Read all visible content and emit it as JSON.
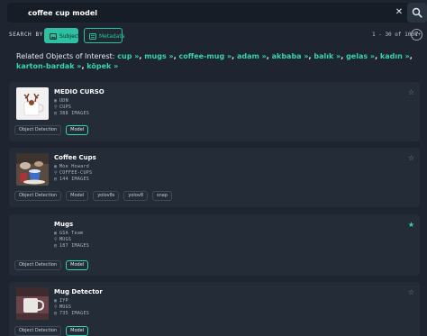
{
  "search": {
    "value": "coffee cup model",
    "clear_label": "✕"
  },
  "search_by": {
    "label": "SEARCH BY:",
    "subject_label": "Subject",
    "metadata_label": "Metadata",
    "result_count": "1 - 30 of 100k+",
    "info_label": "?"
  },
  "related": {
    "title": "Related Objects of Interest:",
    "items": [
      "cup",
      "mugs",
      "coffee-mug",
      "adam",
      "akbaba",
      "balık",
      "gelas",
      "kadın",
      "karton-bardak",
      "köpek"
    ]
  },
  "results": [
    {
      "title": "MEDIO CURSO",
      "owner": "UDN",
      "category": "CUPS",
      "images": "388 IMAGES",
      "favorite": false,
      "tags": [
        "Object Detection",
        "Model"
      ]
    },
    {
      "title": "Coffee Cups",
      "owner": "Moe Howard",
      "category": "COFFEE-CUPS",
      "images": "144 IMAGES",
      "favorite": false,
      "tags": [
        "Object Detection",
        "Model",
        "yolov8s",
        "yolov8",
        "snap"
      ]
    },
    {
      "title": "Mugs",
      "owner": "GSA Team",
      "category": "MUGS",
      "images": "187 IMAGES",
      "favorite": true,
      "tags": [
        "Object Detection",
        "Model"
      ]
    },
    {
      "title": "Mug Detector",
      "owner": "IYP",
      "category": "MUGS",
      "images": "735 IMAGES",
      "favorite": false,
      "tags": [
        "Object Detection",
        "Model"
      ]
    }
  ],
  "colors": {
    "background": "#1e2530",
    "card": "#242c37",
    "accent": "#2fbfa2",
    "link": "#35d3b0"
  }
}
